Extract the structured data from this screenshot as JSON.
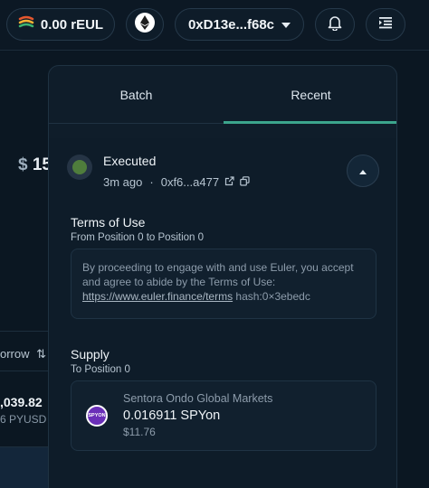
{
  "header": {
    "balance": "0.00 rEUL",
    "wallet_address": "0xD13e...f68c"
  },
  "background": {
    "price_symbol": "$",
    "price_partial": "15",
    "borrow_label": "orrow",
    "value_primary": ",039.82",
    "value_secondary": "6 PYUSD"
  },
  "panel": {
    "tabs": [
      {
        "label": "Batch"
      },
      {
        "label": "Recent"
      }
    ],
    "active_tab": "Recent",
    "transaction": {
      "status": "Executed",
      "time_ago": "3m ago",
      "separator": "·",
      "tx_hash": "0xf6...a477"
    },
    "terms": {
      "title": "Terms of Use",
      "subtitle": "From Position 0 to Position 0",
      "text_1": "By proceeding to engage with and use Euler, you accept and agree to abide by the Terms of Use: ",
      "link": "https://www.euler.finance/terms",
      "text_2": " hash:0×3ebedc"
    },
    "supply": {
      "title": "Supply",
      "subtitle": "To Position 0",
      "token_name": "Sentora Ondo Global Markets",
      "amount": "0.016911 SPYon",
      "usd_value": "$11.76",
      "logo_text": "SPYON"
    }
  },
  "colors": {
    "accent": "#3ca58c",
    "status_executed": "#4f7d3c",
    "token_logo": "#6a2fb8"
  }
}
